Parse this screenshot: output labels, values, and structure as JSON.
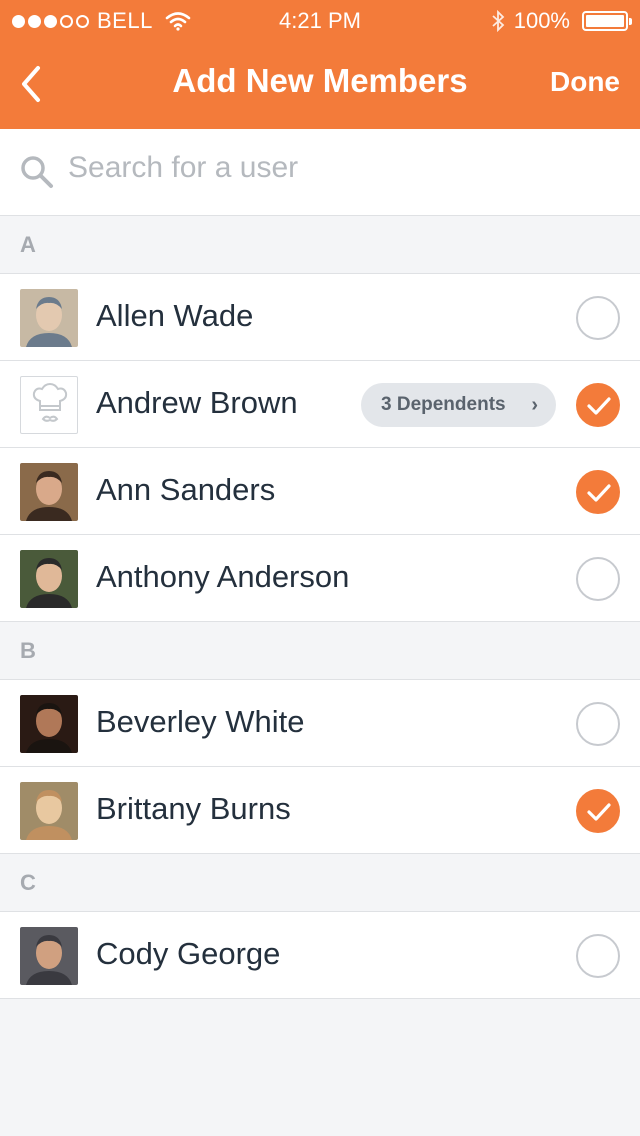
{
  "status_bar": {
    "carrier": "BELL",
    "time": "4:21 PM",
    "battery": "100%",
    "signal_bars": 3,
    "signal_total": 5
  },
  "nav": {
    "title": "Add New Members",
    "done_label": "Done"
  },
  "search": {
    "placeholder": "Search for a user",
    "value": ""
  },
  "colors": {
    "accent": "#f37b3a",
    "text": "#24303d",
    "section_text": "#a6aab0"
  },
  "sections": [
    {
      "letter": "A",
      "members": [
        {
          "name": "Allen Wade",
          "checked": false,
          "avatar": "photo"
        },
        {
          "name": "Andrew Brown",
          "checked": true,
          "avatar": "chef-hat-placeholder",
          "badge": "3 Dependents"
        },
        {
          "name": "Ann Sanders",
          "checked": true,
          "avatar": "photo"
        },
        {
          "name": "Anthony Anderson",
          "checked": false,
          "avatar": "photo"
        }
      ]
    },
    {
      "letter": "B",
      "members": [
        {
          "name": "Beverley White",
          "checked": false,
          "avatar": "photo"
        },
        {
          "name": "Brittany Burns",
          "checked": true,
          "avatar": "photo"
        }
      ]
    },
    {
      "letter": "C",
      "members": [
        {
          "name": "Cody George",
          "checked": false,
          "avatar": "photo"
        }
      ]
    }
  ]
}
